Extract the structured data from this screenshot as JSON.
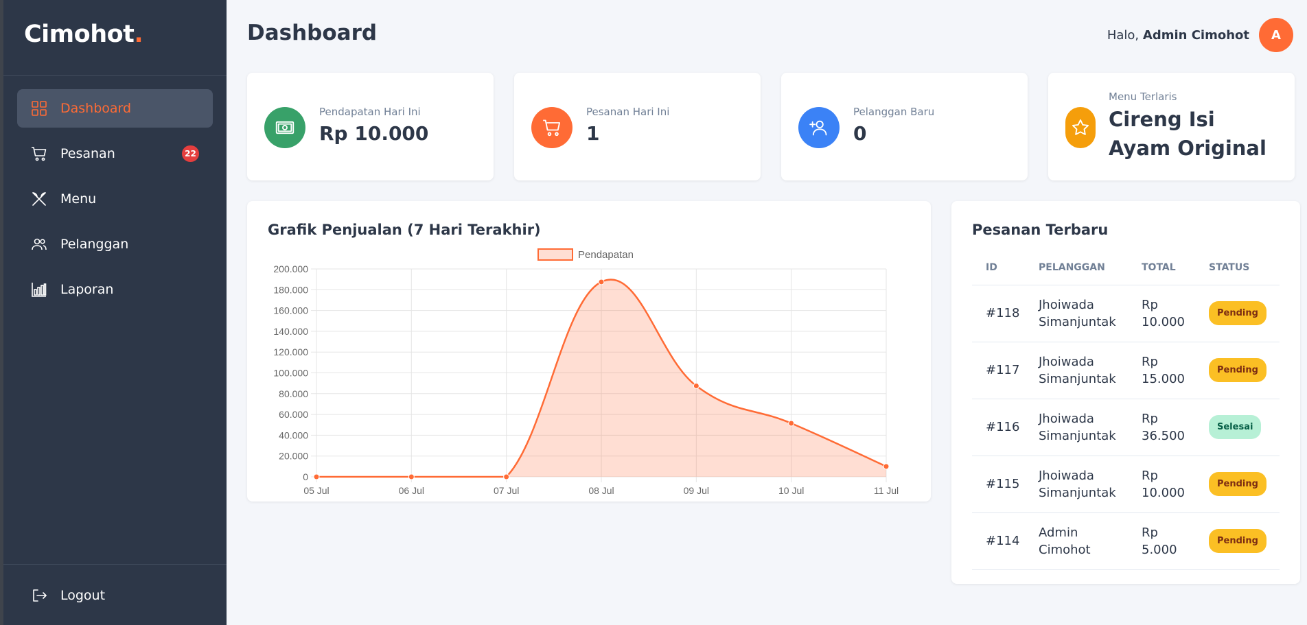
{
  "brand": {
    "name": "Cimohot",
    "dot": "."
  },
  "sidebar": {
    "items": [
      {
        "label": "Dashboard",
        "icon": "grid-icon",
        "active": true
      },
      {
        "label": "Pesanan",
        "icon": "cart-icon",
        "badge": "22"
      },
      {
        "label": "Menu",
        "icon": "utensils-icon"
      },
      {
        "label": "Pelanggan",
        "icon": "users-icon"
      },
      {
        "label": "Laporan",
        "icon": "bar-chart-icon"
      }
    ],
    "logout_label": "Logout"
  },
  "header": {
    "title": "Dashboard",
    "greeting_prefix": "Halo,",
    "user_name": "Admin Cimohot",
    "avatar_initial": "A"
  },
  "stats": [
    {
      "label": "Pendapatan Hari Ini",
      "value": "Rp 10.000",
      "icon": "money-icon",
      "color": "#38a169"
    },
    {
      "label": "Pesanan Hari Ini",
      "value": "1",
      "icon": "cart-icon",
      "color": "#ff6b35"
    },
    {
      "label": "Pelanggan Baru",
      "value": "0",
      "icon": "user-plus-icon",
      "color": "#3b82f6"
    },
    {
      "label": "Menu Terlaris",
      "value": "Cireng Isi Ayam Original",
      "icon": "star-icon",
      "color": "#f59e0b"
    }
  ],
  "chart": {
    "title": "Grafik Penjualan (7 Hari Terakhir)"
  },
  "chart_data": {
    "type": "line",
    "title": "Grafik Penjualan (7 Hari Terakhir)",
    "categories": [
      "05 Jul",
      "06 Jul",
      "07 Jul",
      "08 Jul",
      "09 Jul",
      "10 Jul",
      "11 Jul"
    ],
    "series": [
      {
        "name": "Pendapatan",
        "values": [
          0,
          0,
          0,
          187500,
          87500,
          51500,
          10000
        ],
        "color": "#ff6b35",
        "fill": "rgba(255,107,53,0.22)"
      }
    ],
    "ylim": [
      0,
      200000
    ],
    "y_ticks": [
      "0",
      "20.000",
      "40.000",
      "60.000",
      "80.000",
      "100.000",
      "120.000",
      "140.000",
      "160.000",
      "180.000",
      "200.000"
    ],
    "grid": true,
    "legend": "top-center",
    "area": true,
    "smooth": true
  },
  "orders": {
    "title": "Pesanan Terbaru",
    "headers": [
      "ID",
      "PELANGGAN",
      "TOTAL",
      "STATUS"
    ],
    "rows": [
      {
        "id": "#118",
        "customer_first": "Jhoiwada",
        "customer_last": "Simanjuntak",
        "total_prefix": "Rp",
        "total_value": "10.000",
        "status": "Pending"
      },
      {
        "id": "#117",
        "customer_first": "Jhoiwada",
        "customer_last": "Simanjuntak",
        "total_prefix": "Rp",
        "total_value": "15.000",
        "status": "Pending"
      },
      {
        "id": "#116",
        "customer_first": "Jhoiwada",
        "customer_last": "Simanjuntak",
        "total_prefix": "Rp",
        "total_value": "36.500",
        "status": "Selesai"
      },
      {
        "id": "#115",
        "customer_first": "Jhoiwada",
        "customer_last": "Simanjuntak",
        "total_prefix": "Rp",
        "total_value": "10.000",
        "status": "Pending"
      },
      {
        "id": "#114",
        "customer_first": "Admin",
        "customer_last": "Cimohot",
        "total_prefix": "Rp",
        "total_value": "5.000",
        "status": "Pending"
      }
    ]
  }
}
